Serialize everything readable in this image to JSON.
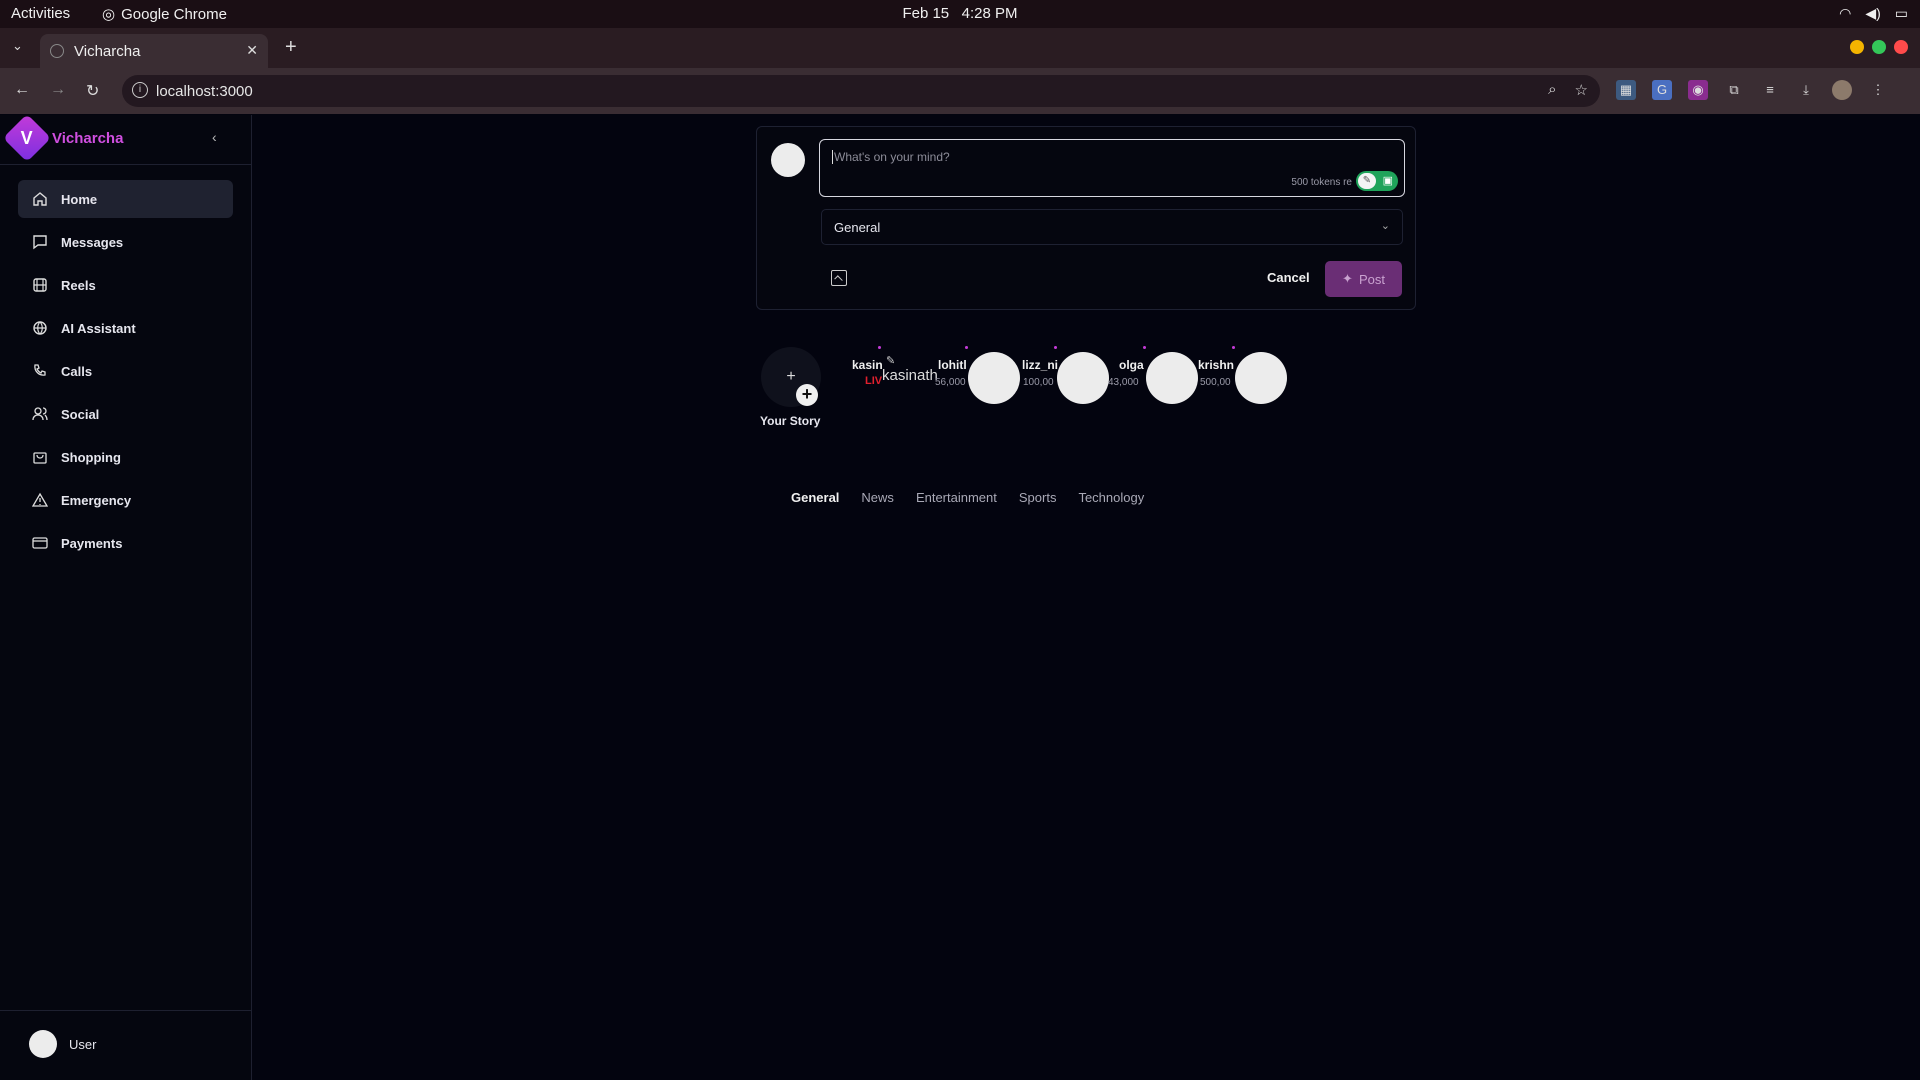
{
  "os": {
    "activities": "Activities",
    "app_name": "Google Chrome",
    "date": "Feb 15",
    "time": "4:28 PM"
  },
  "browser": {
    "tab_title": "Vicharcha",
    "url": "localhost:3000"
  },
  "sidebar": {
    "brand_letter": "V",
    "brand_name": "Vicharcha",
    "items": [
      {
        "label": "Home",
        "icon": "home-icon",
        "active": true
      },
      {
        "label": "Messages",
        "icon": "message-icon"
      },
      {
        "label": "Reels",
        "icon": "film-icon"
      },
      {
        "label": "AI Assistant",
        "icon": "globe-icon"
      },
      {
        "label": "Calls",
        "icon": "phone-icon"
      },
      {
        "label": "Social",
        "icon": "users-icon"
      },
      {
        "label": "Shopping",
        "icon": "shopping-bag-icon"
      },
      {
        "label": "Emergency",
        "icon": "alert-triangle-icon"
      },
      {
        "label": "Payments",
        "icon": "credit-card-icon"
      }
    ],
    "user_name": "User"
  },
  "composer": {
    "placeholder": "What's on your mind?",
    "tokens_text": "500 tokens re",
    "category": "General",
    "cancel_label": "Cancel",
    "post_label": "Post"
  },
  "stories": {
    "your_story_label": "Your Story",
    "live_badge": "LIV",
    "overlay_name": "kasinath",
    "items": [
      {
        "name": "kasin",
        "count": ""
      },
      {
        "name": "lohitl",
        "count": "56,000"
      },
      {
        "name": "lizz_ni",
        "count": "100,00"
      },
      {
        "name": "olga",
        "count": "43,000"
      },
      {
        "name": "krishn",
        "count": "500,00"
      }
    ]
  },
  "feed_tabs": [
    {
      "label": "General",
      "active": true
    },
    {
      "label": "News"
    },
    {
      "label": "Entertainment"
    },
    {
      "label": "Sports"
    },
    {
      "label": "Technology"
    }
  ],
  "colors": {
    "accent": "#c43bd8",
    "background": "#03040f",
    "post_button": "#6a2e75",
    "toggle_on": "#1fa35a",
    "live": "#e0202e"
  }
}
